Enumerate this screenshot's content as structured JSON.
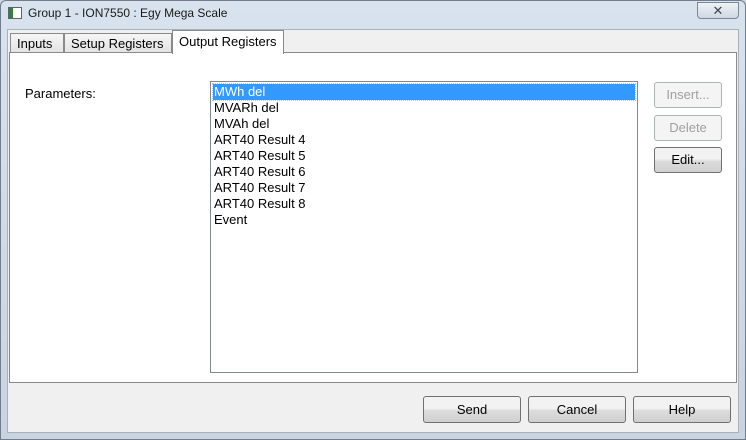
{
  "window": {
    "title": "Group 1 - ION7550 : Egy Mega Scale",
    "close_glyph": "✕"
  },
  "tabs": [
    {
      "label": "Inputs",
      "active": false
    },
    {
      "label": "Setup Registers",
      "active": false
    },
    {
      "label": "Output Registers",
      "active": true
    }
  ],
  "panel": {
    "parameters_label": "Parameters:",
    "parameters": [
      "MWh del",
      "MVARh del",
      "MVAh del",
      "ART40 Result 4",
      "ART40 Result 5",
      "ART40 Result 6",
      "ART40 Result 7",
      "ART40 Result 8",
      "Event"
    ],
    "selected_parameter": "MWh del",
    "buttons": {
      "insert": "Insert...",
      "delete": "Delete",
      "edit": "Edit..."
    }
  },
  "footer": {
    "send": "Send",
    "cancel": "Cancel",
    "help": "Help"
  },
  "colors": {
    "selection": "#3399ff",
    "disabled_text": "#a0a0a0"
  }
}
